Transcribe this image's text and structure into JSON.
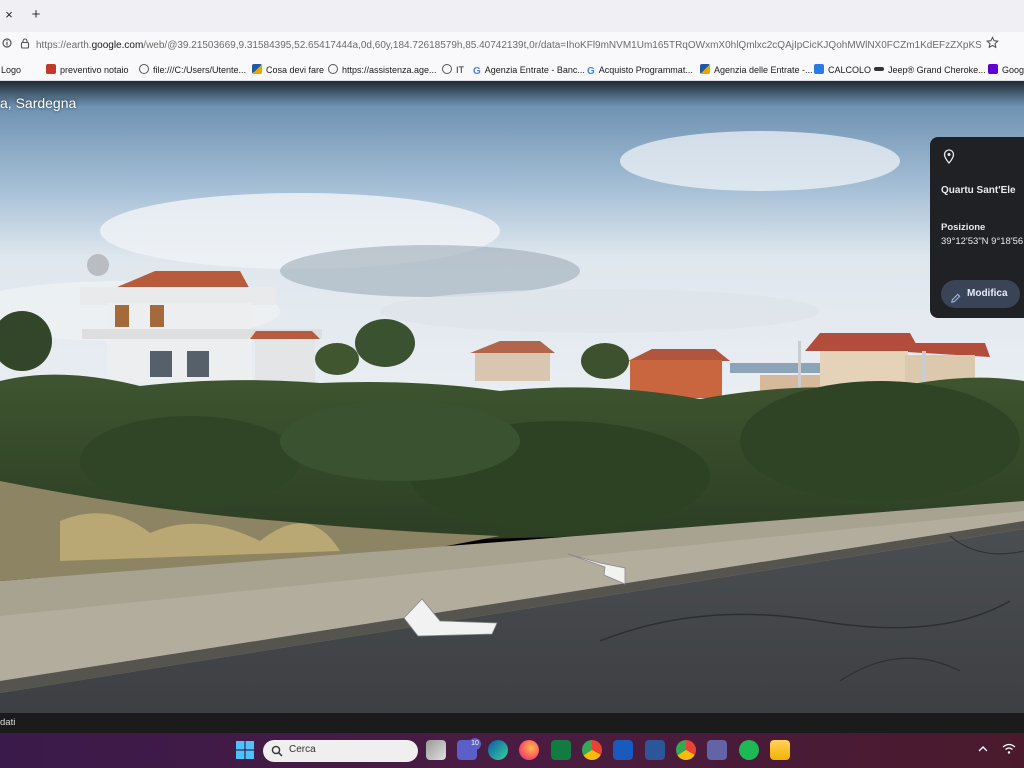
{
  "browser": {
    "tab_close": "×",
    "tab_new": "+",
    "url_prefix": "https://earth.",
    "url_domain": "google.com",
    "url_rest": "/web/@39.21503669,9.31584395,52.65417444a,0d,60y,184.72618579h,85.40742139t,0r/data=IhoKFl9mNVM1Um165TRqOWxmX0hlQmlxc2cQAjIpCicKJQohMWlNX0FCZm1KdEFzZXpKSjdv",
    "bookmarks": [
      {
        "label": "Logo",
        "icon": "none"
      },
      {
        "label": "preventivo notaio",
        "icon": "nf-icon"
      },
      {
        "label": "file:///C:/Users/Utente...",
        "icon": "globe-icon"
      },
      {
        "label": "Cosa devi fare",
        "icon": "ade-icon"
      },
      {
        "label": "https://assistenza.age...",
        "icon": "globe-icon"
      },
      {
        "label": "IT",
        "icon": "globe-icon"
      },
      {
        "label": "Agenzia Entrate - Banc...",
        "icon": "google-icon"
      },
      {
        "label": "Acquisto Programmat...",
        "icon": "google-icon"
      },
      {
        "label": "Agenzia delle Entrate -...",
        "icon": "ade-icon"
      },
      {
        "label": "CALCOLO",
        "icon": "calc-icon"
      },
      {
        "label": "Jeep® Grand Cheroke...",
        "icon": "jeep-icon"
      },
      {
        "label": "Googl",
        "icon": "yahoo-icon"
      }
    ]
  },
  "streetview": {
    "location_title": "a, Sardegna",
    "info_card": {
      "place_name": "Quartu Sant'Ele",
      "position_label": "Posizione",
      "position_value": "39°12'53\"N 9°18'56",
      "edit_button": "Modifica"
    },
    "data_credit": "dati"
  },
  "taskbar": {
    "search_placeholder": "Cerca",
    "notification_count": "10",
    "apps": [
      "task-view",
      "teams-chat",
      "edge",
      "firefox",
      "excel",
      "chrome",
      "word",
      "app-icon",
      "chrome-alt",
      "teams",
      "spotify",
      "file-explorer"
    ]
  },
  "colors": {
    "card_bg": "#202124",
    "edit_button_bg": "#394457",
    "taskbar_from": "#3a1a4a",
    "taskbar_to": "#4a1a2c"
  }
}
